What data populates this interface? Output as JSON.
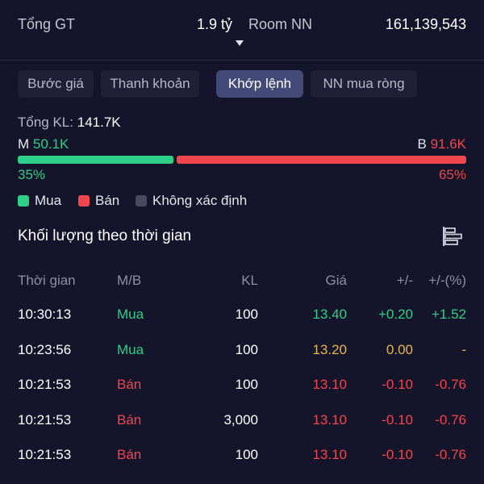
{
  "stats": {
    "tong_gt_label": "Tổng GT",
    "tong_gt_value": "1.9 tỷ",
    "room_label": "Room NN",
    "room_value": "161,139,543"
  },
  "tabs": [
    {
      "label": "Bước giá",
      "active": false
    },
    {
      "label": "Thanh khoản",
      "active": false
    },
    {
      "label": "Khớp lệnh",
      "active": true
    },
    {
      "label": "NN mua ròng",
      "active": false
    }
  ],
  "summary": {
    "total_label": "Tổng KL:",
    "total_value": "141.7K",
    "m_label": "M",
    "m_value": "50.1K",
    "b_label": "B",
    "b_value": "91.6K",
    "m_pct_text": "35%",
    "b_pct_text": "65%",
    "m_fraction": 0.35,
    "b_fraction": 0.65
  },
  "legend": [
    {
      "label": "Mua",
      "color": "#2ecf86"
    },
    {
      "label": "Bán",
      "color": "#f0464e"
    },
    {
      "label": "Không xác định",
      "color": "#4a4a5e"
    }
  ],
  "section": {
    "title": "Khối lượng theo thời gian",
    "icon": "bar-chart-horizontal-icon"
  },
  "table": {
    "headers": {
      "time": "Thời gian",
      "mb": "M/B",
      "kl": "KL",
      "gia": "Giá",
      "chg": "+/-",
      "pct": "+/-(%)"
    },
    "rows": [
      {
        "time": "10:30:13",
        "mb": "Mua",
        "kl": "100",
        "gia": "13.40",
        "chg": "+0.20",
        "pct": "+1.52",
        "side": "buy",
        "trend": "up"
      },
      {
        "time": "10:23:56",
        "mb": "Mua",
        "kl": "100",
        "gia": "13.20",
        "chg": "0.00",
        "pct": "-",
        "side": "buy",
        "trend": "flat"
      },
      {
        "time": "10:21:53",
        "mb": "Bán",
        "kl": "100",
        "gia": "13.10",
        "chg": "-0.10",
        "pct": "-0.76",
        "side": "sell",
        "trend": "down"
      },
      {
        "time": "10:21:53",
        "mb": "Bán",
        "kl": "3,000",
        "gia": "13.10",
        "chg": "-0.10",
        "pct": "-0.76",
        "side": "sell",
        "trend": "down"
      },
      {
        "time": "10:21:53",
        "mb": "Bán",
        "kl": "100",
        "gia": "13.10",
        "chg": "-0.10",
        "pct": "-0.76",
        "side": "sell",
        "trend": "down"
      }
    ]
  },
  "colors": {
    "buy": "#2ecf86",
    "sell": "#f0464e",
    "flat": "#e8b657"
  }
}
